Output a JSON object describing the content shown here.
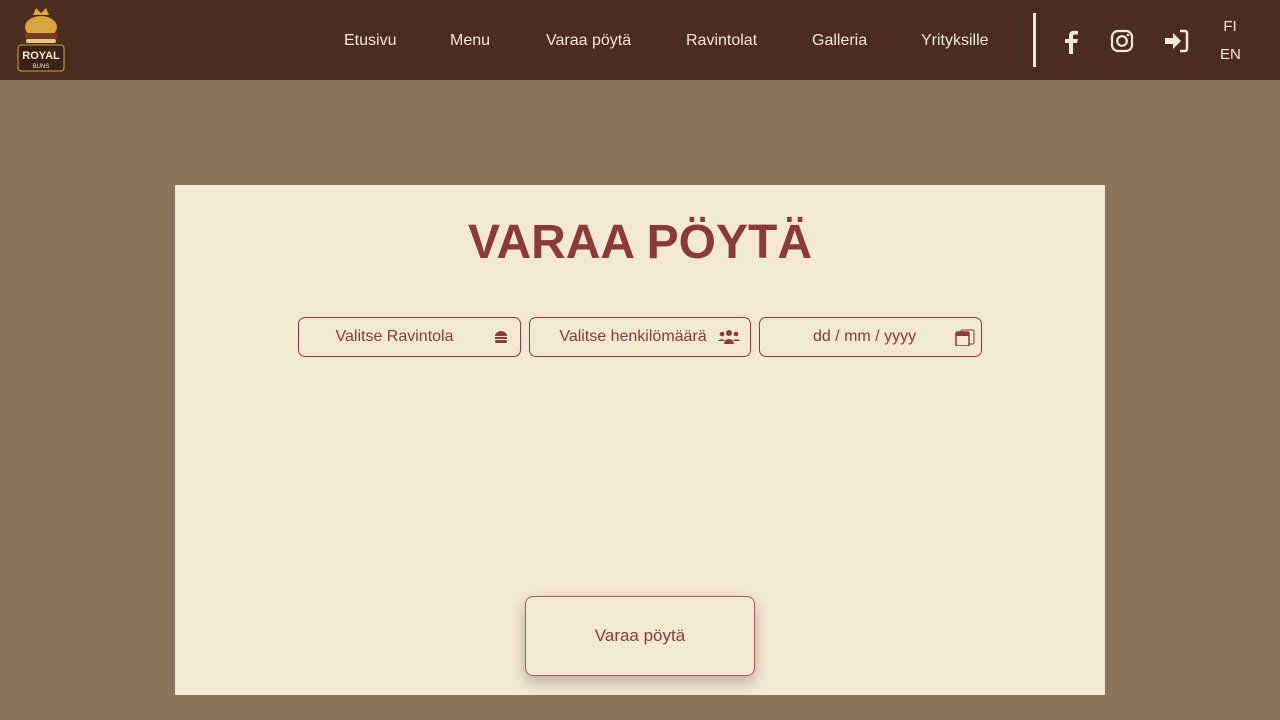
{
  "nav": {
    "logo_text": "ROYAL BUNS",
    "links": [
      "Etusivu",
      "Menu",
      "Varaa pöytä",
      "Ravintolat",
      "Galleria",
      "Yrityksille"
    ],
    "icons": [
      "facebook-icon",
      "instagram-icon",
      "login-icon"
    ],
    "languages": [
      "FI",
      "EN"
    ]
  },
  "main": {
    "title": "VARAA PÖYTÄ",
    "restaurant_placeholder": "Valitse Ravintola",
    "people_placeholder": "Valitse henkilömäärä",
    "date_placeholder": "dd / mm / yyyy",
    "submit_label": "Varaa pöytä"
  },
  "colors": {
    "nav_bg": "#4a2c20",
    "page_bg": "#89765d",
    "card_bg": "#f3e8d4",
    "accent": "#8b3a3a",
    "nav_text": "#f3e8d4"
  }
}
